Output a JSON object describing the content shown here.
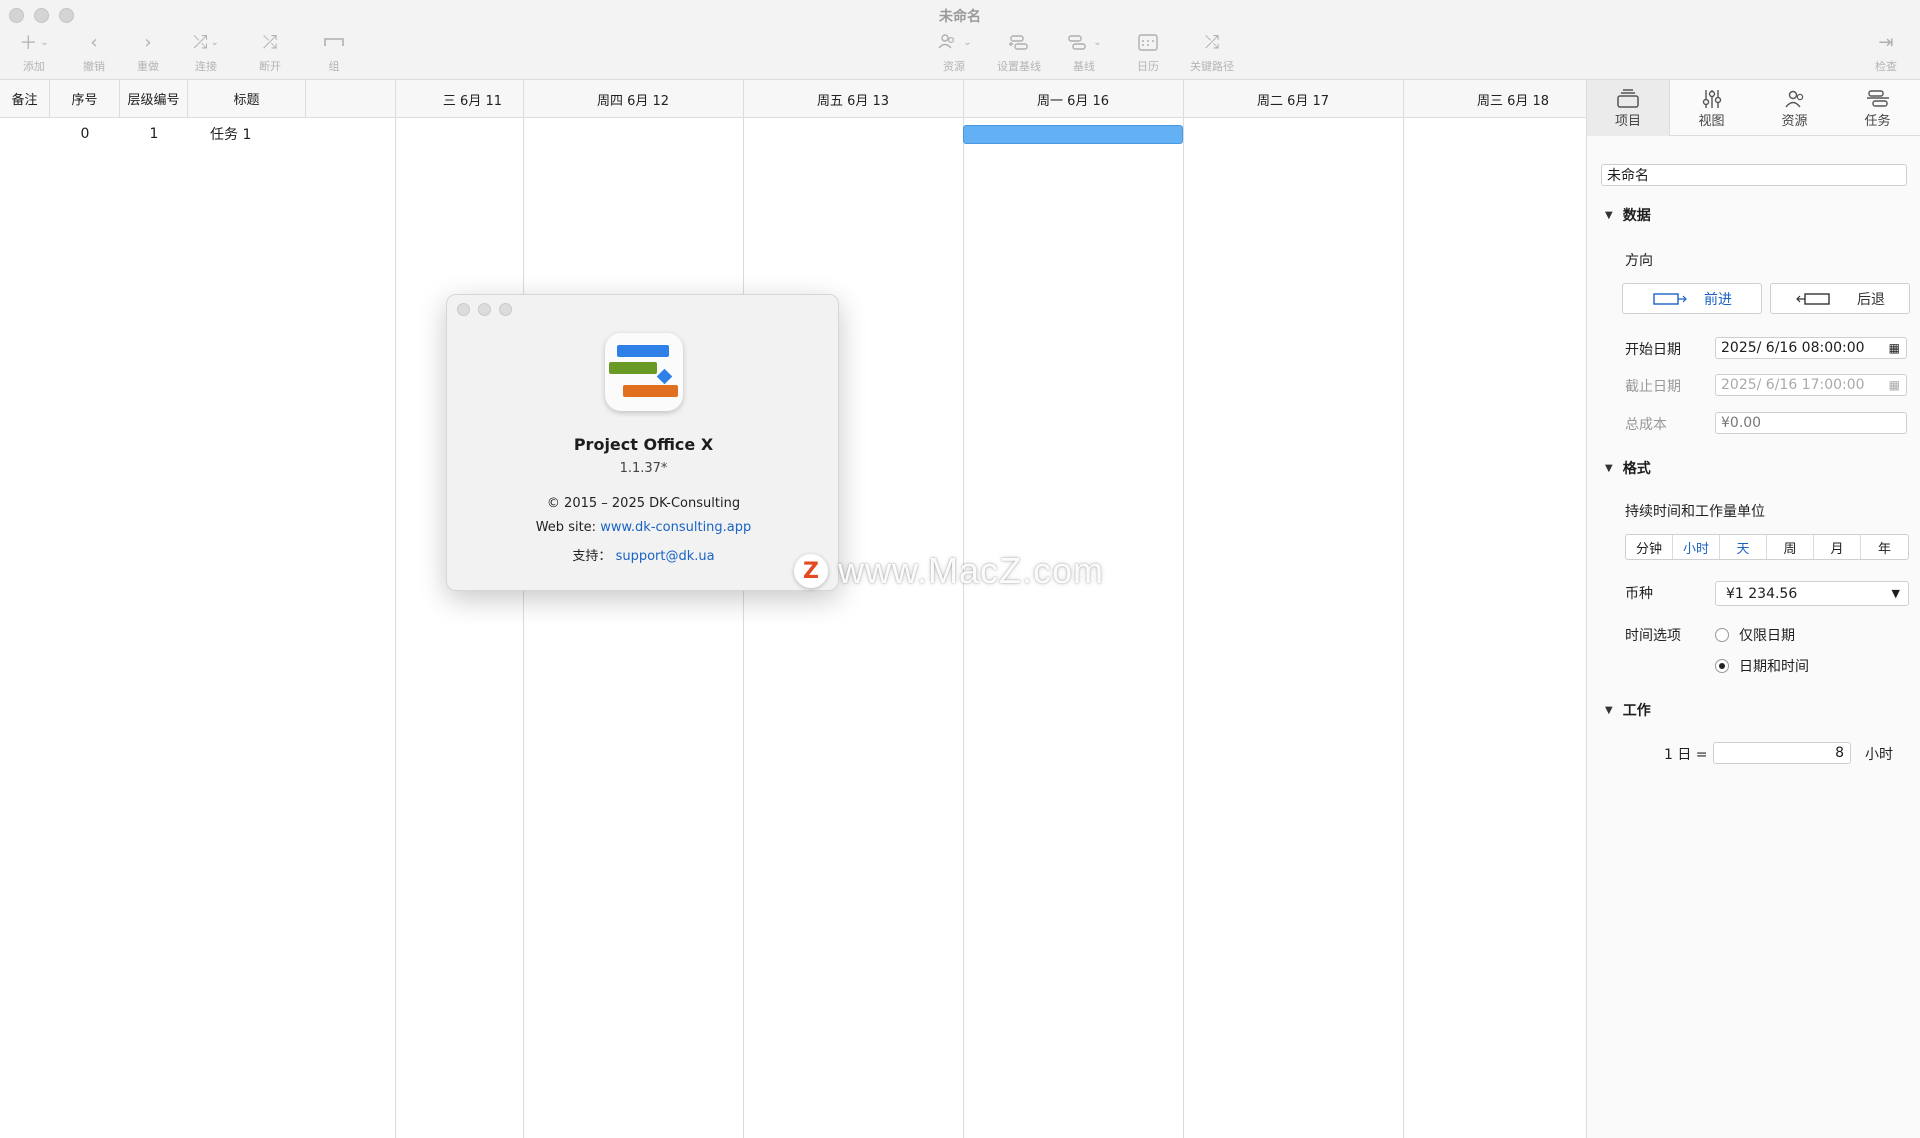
{
  "window": {
    "title": "未命名"
  },
  "toolbar": {
    "add": "添加",
    "undo": "撤销",
    "redo": "重做",
    "link": "连接",
    "unlink": "断开",
    "group": "组",
    "resources": "资源",
    "set_baseline": "设置基线",
    "baseline": "基线",
    "calendar": "日历",
    "critical_path": "关键路径",
    "inspect": "检查"
  },
  "table": {
    "columns": [
      "备注",
      "序号",
      "层级编号",
      "标题"
    ],
    "rows": [
      {
        "note": "",
        "index": "0",
        "wbs": "1",
        "title": "任务 1"
      }
    ]
  },
  "gantt": {
    "days": [
      "三 6月 11",
      "周四 6月 12",
      "周五 6月 13",
      "周一 6月 16",
      "周二 6月 17",
      "周三 6月 18"
    ]
  },
  "inspector": {
    "tabs": [
      "项目",
      "视图",
      "资源",
      "任务"
    ],
    "project_name": "未命名",
    "data_section": "数据",
    "direction_label": "方向",
    "forward": "前进",
    "backward": "后退",
    "start_label": "开始日期",
    "start_value": "2025/ 6/16 08:00:00",
    "end_label": "截止日期",
    "end_value": "2025/ 6/16 17:00:00",
    "cost_label": "总成本",
    "cost_value": "¥0.00",
    "format_section": "格式",
    "unit_label": "持续时间和工作量单位",
    "units": [
      "分钟",
      "小时",
      "天",
      "周",
      "月",
      "年"
    ],
    "currency_label": "币种",
    "currency_value": "¥1 234.56",
    "time_label": "时间选项",
    "time_opt1": "仅限日期",
    "time_opt2": "日期和时间",
    "work_section": "工作",
    "day_eq": "1 日 =",
    "hours_value": "8",
    "hours_unit": "小时"
  },
  "about": {
    "app_name": "Project Office X",
    "version": "1.1.37*",
    "copyright": "© 2015 – 2025 DK-Consulting",
    "website_label": "Web site:",
    "website": "www.dk-consulting.app",
    "support_label": "支持：",
    "support": "support@dk.ua"
  },
  "watermark": {
    "text": "www.MacZ.com",
    "badge": "Z"
  }
}
